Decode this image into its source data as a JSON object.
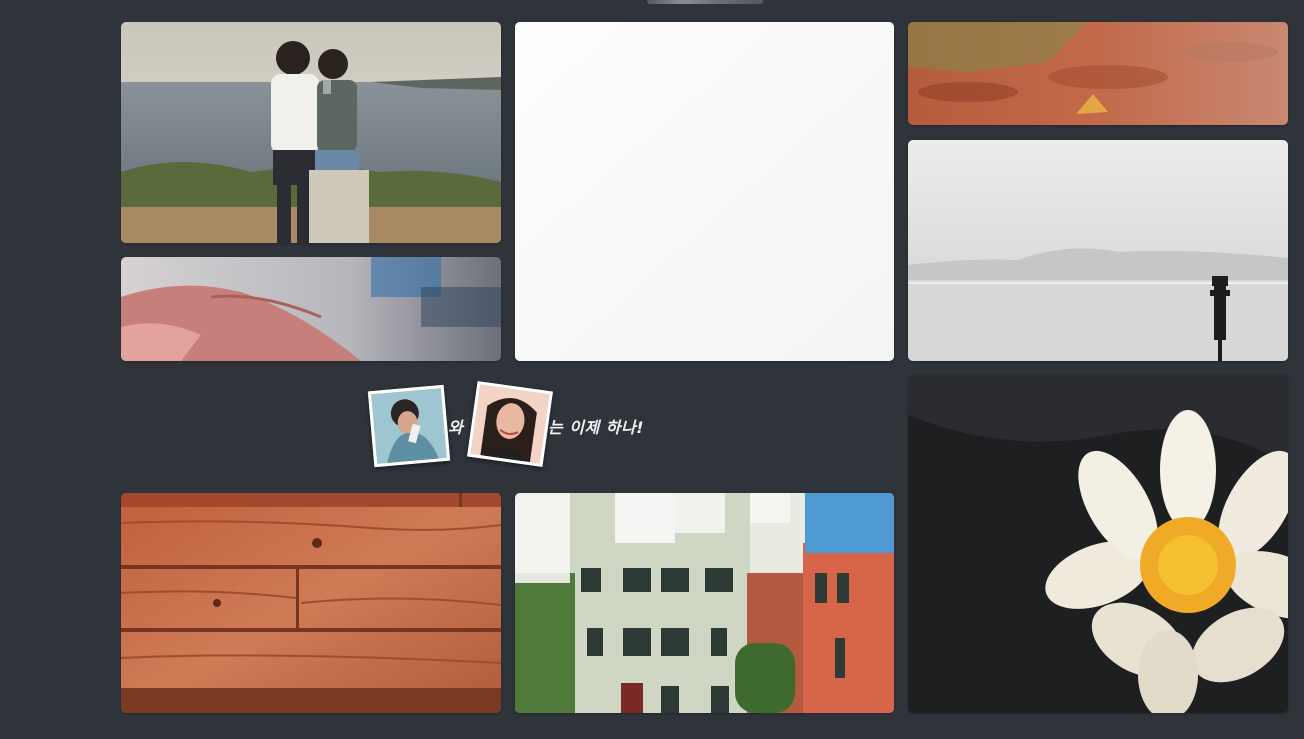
{
  "banner": {
    "word_1": "와",
    "word_2": "는 이제 하나!"
  },
  "colors": {
    "background": "#2f333a",
    "banner_text": "#eef0f2"
  },
  "gallery": {
    "tiles": [
      "couple-beach-photo",
      "white-blank-photo",
      "autumn-leaves-photo",
      "hand-closeup-photo",
      "misty-sea-photo",
      "white-lotus-photo",
      "wood-plank-photo",
      "venice-buildings-photo"
    ]
  }
}
